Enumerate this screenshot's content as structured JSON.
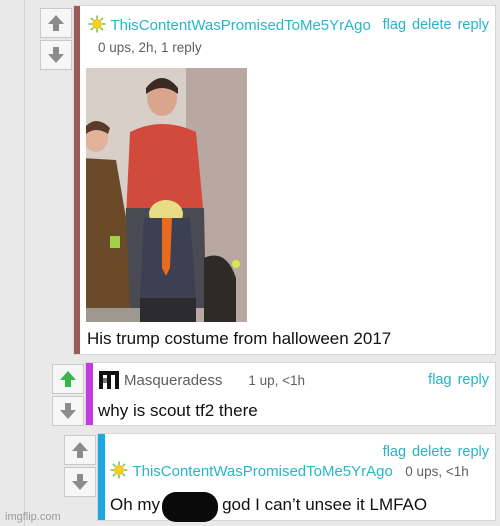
{
  "c1": {
    "username": "ThisContentWasPromisedToMe5YrAgo",
    "meta": "0 ups, 2h, 1 reply",
    "actions": [
      "flag",
      "delete",
      "reply"
    ],
    "caption": "His trump costume from halloween 2017",
    "accent_color": "#9e5a5a",
    "avatar_icon": "sun-icon"
  },
  "c2": {
    "username": "Masqueradess",
    "meta": "1 up, <1h",
    "actions": [
      "flag",
      "reply"
    ],
    "text": "why is scout tf2 there",
    "accent_color": "#c23ae0",
    "avatar_icon": "pixel-avatar-icon",
    "upvoted": true
  },
  "c3": {
    "username": "ThisContentWasPromisedToMe5YrAgo",
    "meta": "0 ups, <1h",
    "actions": [
      "flag",
      "delete",
      "reply"
    ],
    "text_before": "Oh my",
    "text_after": "god I can’t unsee it LMFAO",
    "accent_color": "#1ea8e0",
    "avatar_icon": "sun-icon"
  },
  "watermark": "imgflip.com",
  "colors": {
    "link": "#26b3c7",
    "upvote_active": "#39b54a",
    "arrow": "#8c8c8c"
  }
}
